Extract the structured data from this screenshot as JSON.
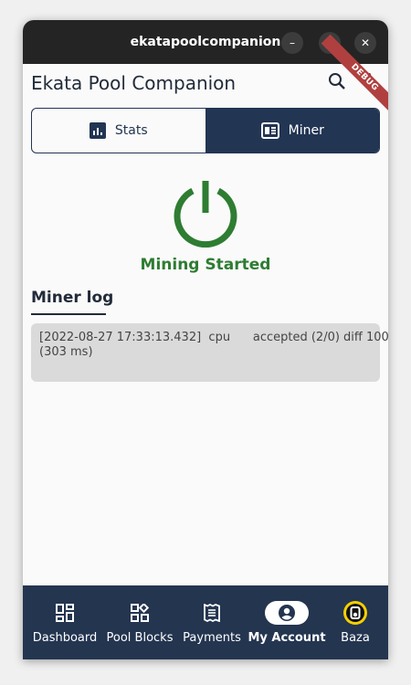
{
  "window": {
    "title": "ekatapoolcompanion",
    "minimize_glyph": "–",
    "maximize_glyph": "□",
    "close_glyph": "✕"
  },
  "appbar": {
    "title": "Ekata Pool Companion",
    "debug_banner": "DEBUG"
  },
  "tabs": [
    {
      "label": "Stats",
      "icon": "bar-chart-icon",
      "selected": false
    },
    {
      "label": "Miner",
      "icon": "miner-icon",
      "selected": true
    }
  ],
  "miner": {
    "status": "Mining Started",
    "status_color": "#2e7d32",
    "log_title": "Miner log",
    "log_line_1": "[2022-08-27 17:33:13.432]  cpu      accepted (2/0) diff 100",
    "log_line_2": "(303 ms)"
  },
  "bottom_nav": [
    {
      "label": "Dashboard",
      "icon": "dashboard-icon"
    },
    {
      "label": "Pool Blocks",
      "icon": "pool-blocks-icon"
    },
    {
      "label": "Payments",
      "icon": "payments-icon"
    },
    {
      "label": "My Account",
      "icon": "account-icon",
      "selected": true
    },
    {
      "label": "Baza",
      "icon": "baza-icon"
    }
  ],
  "colors": {
    "primary": "#223553",
    "nav_bg": "#243550",
    "accent_green": "#2e7d32",
    "debug_red": "#b0403f"
  }
}
